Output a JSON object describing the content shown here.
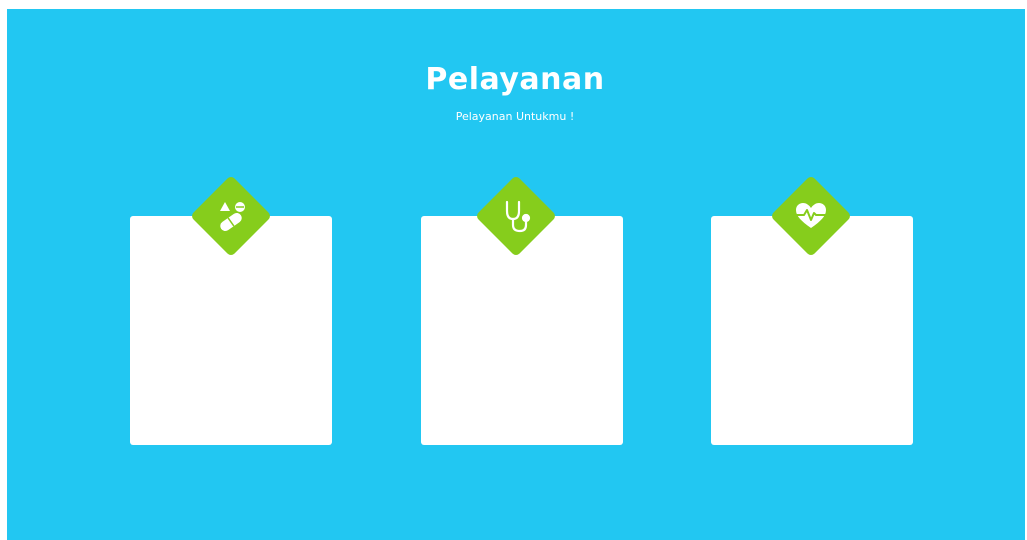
{
  "header": {
    "title": "Pelayanan",
    "subtitle": "Pelayanan Untukmu !"
  },
  "services": [
    {
      "icon": "pills-icon"
    },
    {
      "icon": "stethoscope-icon"
    },
    {
      "icon": "heartbeat-icon"
    }
  ],
  "colors": {
    "background": "#22c7f2",
    "card": "#ffffff",
    "badge": "#86cd1c",
    "text": "#ffffff"
  }
}
